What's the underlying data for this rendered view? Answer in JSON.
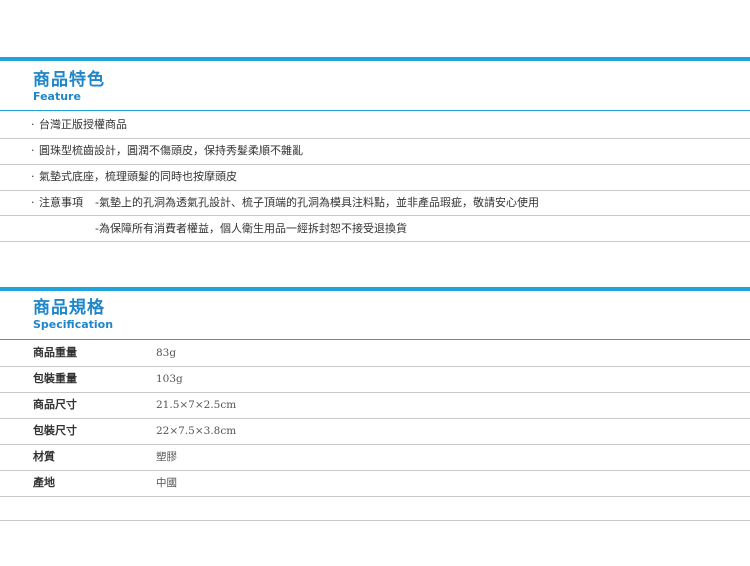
{
  "feature": {
    "title": "商品特色",
    "subtitle": "Feature",
    "bullet": "·",
    "items": [
      "台灣正版授權商品",
      "圓珠型梳齒設計，圓潤不傷頭皮，保持秀髮柔順不雜亂",
      "氣墊式底座，梳理頭髮的同時也按摩頭皮"
    ],
    "notes": {
      "label": "注意事項",
      "lines": [
        "-氣墊上的孔洞為透氣孔設計、梳子頂端的孔洞為模具注料點，並非產品瑕疵，敬請安心使用",
        "-為保障所有消費者權益，個人衛生用品一經拆封恕不接受退換貨"
      ]
    }
  },
  "spec": {
    "title": "商品規格",
    "subtitle": "Specification",
    "rows": [
      {
        "label": "商品重量",
        "value": "83g"
      },
      {
        "label": "包裝重量",
        "value": "103g"
      },
      {
        "label": "商品尺寸",
        "value": "21.5×7×2.5cm"
      },
      {
        "label": "包裝尺寸",
        "value": "22×7.5×3.8cm"
      },
      {
        "label": "材質",
        "value": "塑膠"
      },
      {
        "label": "產地",
        "value": "中國"
      }
    ]
  },
  "colors": {
    "accent": "#1fa3dc",
    "heading": "#1f86c9",
    "divider": "#c9c9c9"
  }
}
